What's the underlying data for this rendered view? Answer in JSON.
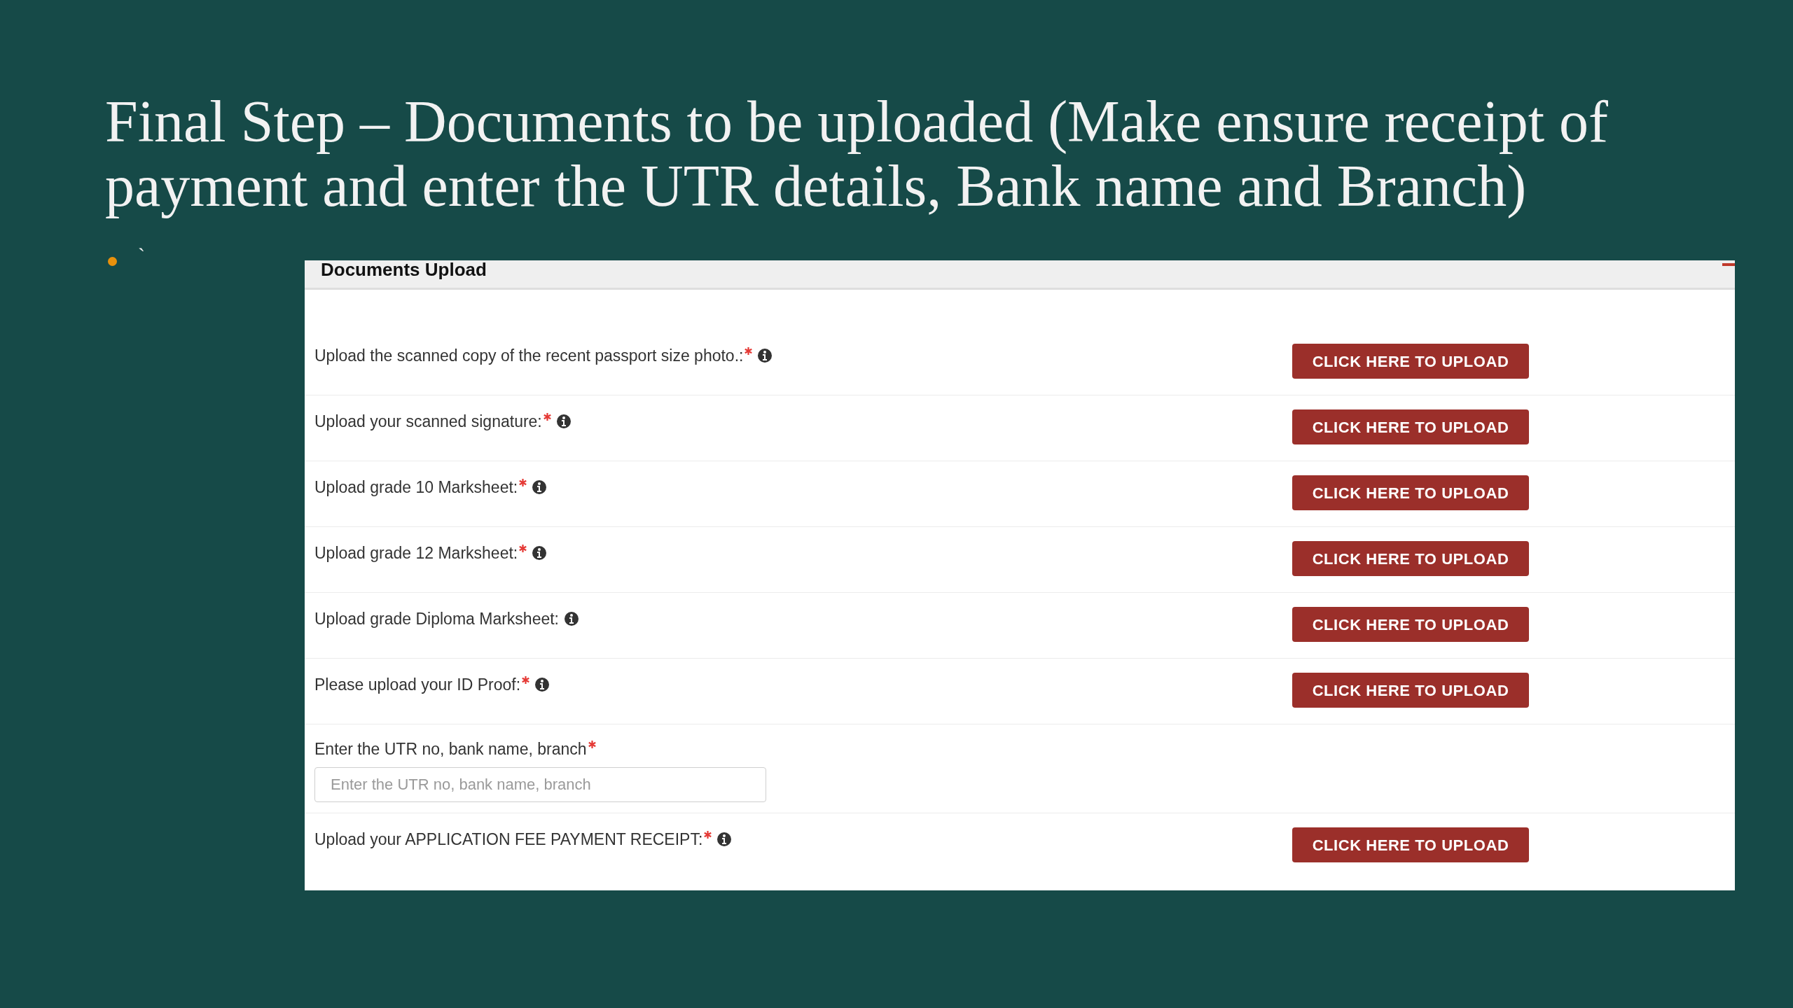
{
  "slide": {
    "title": "Final Step – Documents to be uploaded (Make ensure receipt of payment and enter the UTR details, Bank name and Branch)",
    "bullet": "`"
  },
  "panel": {
    "title": "Documents Upload",
    "rows": [
      {
        "kind": "upload",
        "label": "Upload the scanned copy of the recent passport size photo.:",
        "required": true,
        "info": true,
        "button": "CLICK HERE TO UPLOAD"
      },
      {
        "kind": "upload",
        "label": "Upload your scanned signature:",
        "required": true,
        "info": true,
        "button": "CLICK HERE TO UPLOAD"
      },
      {
        "kind": "upload",
        "label": "Upload grade 10 Marksheet:",
        "required": true,
        "info": true,
        "button": "CLICK HERE TO UPLOAD"
      },
      {
        "kind": "upload",
        "label": "Upload grade 12 Marksheet:",
        "required": true,
        "info": true,
        "button": "CLICK HERE TO UPLOAD"
      },
      {
        "kind": "upload",
        "label": "Upload grade Diploma Marksheet:",
        "required": false,
        "info": true,
        "button": "CLICK HERE TO UPLOAD"
      },
      {
        "kind": "upload",
        "label": "Please upload your ID Proof:",
        "required": true,
        "info": true,
        "button": "CLICK HERE TO UPLOAD"
      },
      {
        "kind": "text_input",
        "label": "Enter the UTR no, bank name, branch",
        "required": true,
        "info": false,
        "placeholder": "Enter the UTR no, bank name, branch"
      },
      {
        "kind": "upload",
        "label": "Upload your APPLICATION FEE PAYMENT RECEIPT:",
        "required": true,
        "info": true,
        "button": "CLICK HERE TO UPLOAD"
      }
    ]
  }
}
